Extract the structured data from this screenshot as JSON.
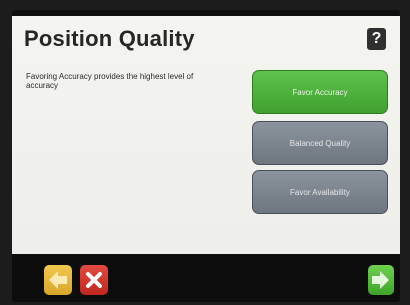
{
  "screen": {
    "title": "Position Quality",
    "help_label": "?",
    "description": "Favoring Accuracy provides the highest level of accuracy"
  },
  "options": [
    {
      "label": "Favor Accuracy",
      "selected": true
    },
    {
      "label": "Balanced Quality",
      "selected": false
    },
    {
      "label": "Favor Availability",
      "selected": false
    }
  ],
  "navigation": {
    "back_icon": "arrow-left-icon",
    "cancel_icon": "close-icon",
    "next_icon": "arrow-right-icon"
  },
  "colors": {
    "selected_option": "#4caf3a",
    "unselected_option": "#7a828b",
    "back_button": "#e8b83c",
    "cancel_button": "#d4382e",
    "next_button": "#55bb3c"
  }
}
